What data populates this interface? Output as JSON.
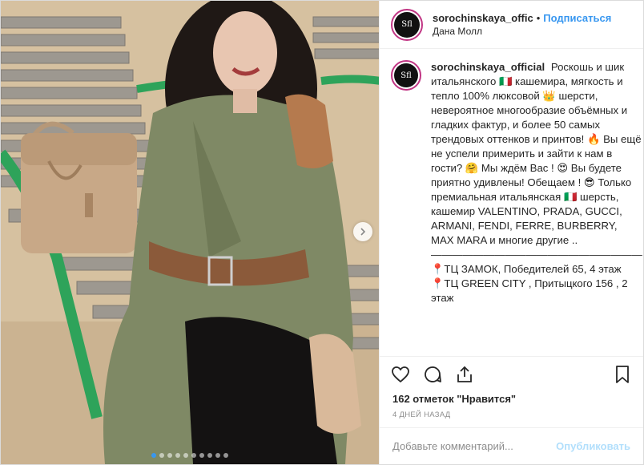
{
  "header": {
    "username": "sorochinskaya_offic",
    "separator": "•",
    "follow_label": "Подписаться",
    "location": "Дана Молл",
    "avatar_text": "Sfl"
  },
  "caption": {
    "username": "sorochinskaya_official",
    "text": "Роскошь и шик итальянского 🇮🇹 кашемира, мягкость и тепло 100% люксовой 👑 шерсти, невероятное многообразие объёмных и гладких фактур, и более 50 самых трендовых оттенков и принтов! 🔥 Вы ещё не успели примерить и зайти к нам в гости? 🤗 Мы ждём Вас ! 😍 Вы будете приятно удивлены! Обещаем ! 😎 Только премиальная итальянская 🇮🇹 шерсть, кашемир VALENTINO, PRADA, GUCCI, ARMANI, FENDI, FERRE, BURBERRY, MAX MARA и многие другие ..\n————————————————————\n📍ТЦ ЗАМОК, Победителей 65, 4 этаж\n📍ТЦ GREEN CITY , Притыцкого 156 , 2 этаж"
  },
  "likes": "162 отметок \"Нравится\"",
  "time": "4 ДНЕЙ НАЗАД",
  "comment_box": {
    "placeholder": "Добавьте комментарий...",
    "publish_label": "Опубликовать"
  },
  "carousel": {
    "dot_count": 10,
    "active_index": 0
  },
  "icons": {
    "like": "heart-icon",
    "comment": "comment-icon",
    "share": "share-icon",
    "save": "bookmark-icon",
    "next": "chevron-right-icon"
  },
  "colors": {
    "link": "#3897f0",
    "avatar_ring": "#c13584",
    "publish": "#b2dffc"
  }
}
